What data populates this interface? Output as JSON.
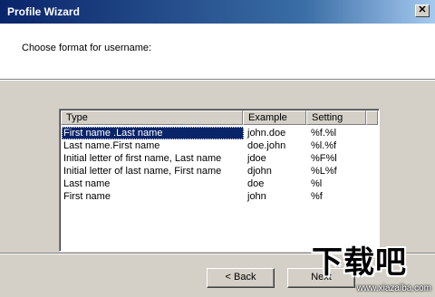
{
  "window": {
    "title": "Profile Wizard",
    "close_glyph": "✕"
  },
  "header": {
    "prompt": "Choose format for username:"
  },
  "list": {
    "columns": [
      "Type",
      "Example",
      "Setting",
      ""
    ],
    "rows": [
      {
        "type": "First name .Last name",
        "example": "john.doe",
        "setting": "%f.%l",
        "selected": true
      },
      {
        "type": "Last name.First name",
        "example": "doe.john",
        "setting": "%l.%f",
        "selected": false
      },
      {
        "type": "Initial letter of first name, Last name",
        "example": "jdoe",
        "setting": "%F%l",
        "selected": false
      },
      {
        "type": "Initial letter of last name, First name",
        "example": "djohn",
        "setting": "%L%f",
        "selected": false
      },
      {
        "type": "Last name",
        "example": "doe",
        "setting": "%l",
        "selected": false
      },
      {
        "type": "First name",
        "example": "john",
        "setting": "%f",
        "selected": false
      }
    ]
  },
  "buttons": {
    "back_label": "< Back",
    "next_label": "Next"
  },
  "watermark": {
    "logo_text": "下载吧",
    "url": "www.xiazaiba.com"
  }
}
